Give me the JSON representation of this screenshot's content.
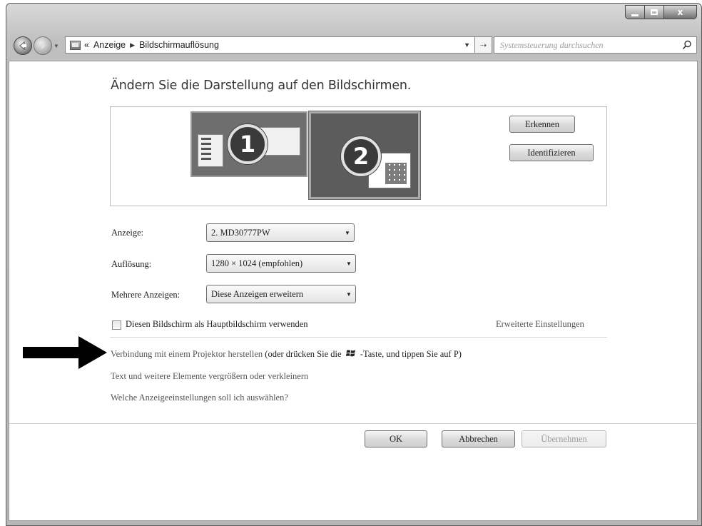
{
  "window": {
    "controls": {
      "minimize": "minimize",
      "maximize": "maximize",
      "close": "x"
    }
  },
  "address_bar": {
    "overflow": "«",
    "crumbs": [
      "Anzeige",
      "Bildschirmauflösung"
    ],
    "search_placeholder": "Systemsteuerung durchsuchen"
  },
  "main": {
    "heading": "Ändern Sie die Darstellung auf den Bildschirmen.",
    "monitors": [
      "1",
      "2"
    ],
    "detect_button": "Erkennen",
    "identify_button": "Identifizieren",
    "fields": {
      "display": {
        "label": "Anzeige:",
        "value": "2. MD30777PW"
      },
      "resolution": {
        "label": "Auflösung:",
        "value": "1280 × 1024 (empfohlen)"
      },
      "multiple": {
        "label": "Mehrere Anzeigen:",
        "value": "Diese Anzeigen erweitern"
      }
    },
    "primary_checkbox_label": "Diesen Bildschirm als Hauptbildschirm verwenden",
    "primary_checked": false,
    "advanced_link": "Erweiterte Einstellungen",
    "projector_link": "Verbindung mit einem Projektor herstellen",
    "projector_hint_a": "(oder drücken Sie die",
    "projector_hint_b": "-Taste, und tippen Sie auf P)",
    "text_size_link": "Text und weitere Elemente vergrößern oder verkleinern",
    "which_settings_link": "Welche Anzeigeeinstellungen soll ich auswählen?"
  },
  "footer": {
    "ok": "OK",
    "cancel": "Abbrechen",
    "apply": "Übernehmen"
  },
  "colors": {
    "arrow": "#000000",
    "selected_monitor": "#5c5c5c",
    "disabled_text": "#9a9a9a"
  }
}
